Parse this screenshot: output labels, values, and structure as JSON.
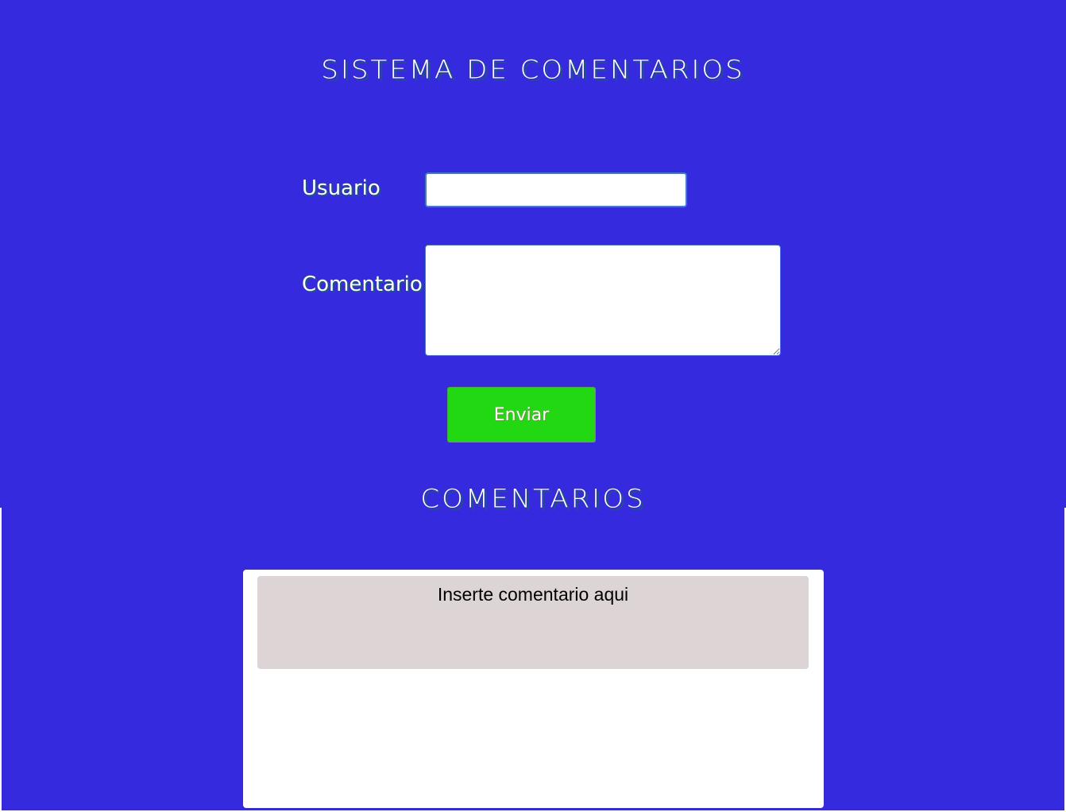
{
  "header": {
    "title": "SISTEMA DE COMENTARIOS"
  },
  "form": {
    "user_label": "Usuario",
    "user_value": "",
    "comment_label": "Comentario",
    "comment_value": "",
    "submit_label": "Enviar"
  },
  "comments": {
    "title": "COMENTARIOS",
    "items": [
      {
        "text": "Inserte comentario aqui"
      }
    ]
  },
  "colors": {
    "background": "#362ade",
    "submit_button": "#22d813",
    "comment_card": "#ddd5d5",
    "panel": "#ffffff"
  }
}
